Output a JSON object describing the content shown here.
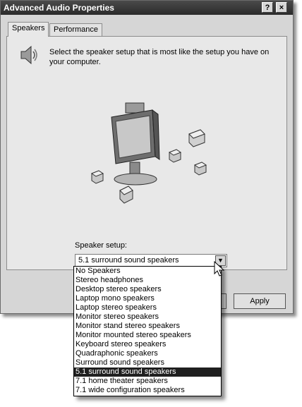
{
  "window": {
    "title": "Advanced Audio Properties",
    "help_button": "?",
    "close_button": "×"
  },
  "tabs": [
    {
      "label": "Speakers",
      "active": true
    },
    {
      "label": "Performance",
      "active": false
    }
  ],
  "instructions": "Select the speaker setup that is most like the setup you have on your computer.",
  "speaker_setup": {
    "label": "Speaker setup:",
    "selected": "5.1 surround sound speakers",
    "options": [
      "No Speakers",
      "Stereo headphones",
      "Desktop stereo speakers",
      "Laptop mono speakers",
      "Laptop stereo speakers",
      "Monitor stereo speakers",
      "Monitor stand stereo speakers",
      "Monitor mounted stereo speakers",
      "Keyboard stereo speakers",
      "Quadraphonic speakers",
      "Surround sound speakers",
      "5.1 surround sound speakers",
      "7.1 home theater speakers",
      "7.1 wide configuration speakers"
    ]
  },
  "buttons": {
    "apply": "Apply"
  },
  "icons": {
    "speaker": "speaker-icon",
    "dropdown_arrow": "chevron-down-icon",
    "cursor": "mouse-pointer-icon"
  }
}
